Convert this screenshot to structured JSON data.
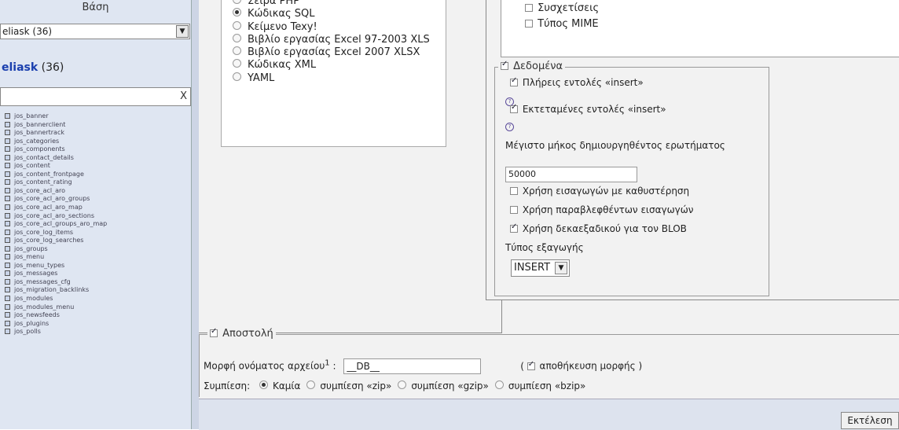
{
  "sidebar": {
    "title": "Βάση",
    "db_select_value": "eliask (36)",
    "db_link_name": "eliask",
    "db_link_count": "(36)",
    "filter_clear": "X",
    "tables": [
      "jos_banner",
      "jos_bannerclient",
      "jos_bannertrack",
      "jos_categories",
      "jos_components",
      "jos_contact_details",
      "jos_content",
      "jos_content_frontpage",
      "jos_content_rating",
      "jos_core_acl_aro",
      "jos_core_acl_aro_groups",
      "jos_core_acl_aro_map",
      "jos_core_acl_aro_sections",
      "jos_core_acl_groups_aro_map",
      "jos_core_log_items",
      "jos_core_log_searches",
      "jos_groups",
      "jos_menu",
      "jos_menu_types",
      "jos_messages",
      "jos_messages_cfg",
      "jos_migration_backlinks",
      "jos_modules",
      "jos_modules_menu",
      "jos_newsfeeds",
      "jos_plugins",
      "jos_polls"
    ]
  },
  "format": {
    "options": [
      {
        "label": "Σειρά PHP",
        "checked": false
      },
      {
        "label": "Κώδικας SQL",
        "checked": true
      },
      {
        "label": "Κείμενο Texy!",
        "checked": false
      },
      {
        "label": "Βιβλίο εργασίας Excel 97-2003 XLS",
        "checked": false
      },
      {
        "label": "Βιβλίο εργασίας Excel 2007 XLSX",
        "checked": false
      },
      {
        "label": "Κώδικας XML",
        "checked": false
      },
      {
        "label": "YAML",
        "checked": false
      }
    ]
  },
  "options_top": {
    "relations_label": "Συσχετίσεις",
    "mime_label": "Τύπος MIME"
  },
  "data_section": {
    "legend": "Δεδομένα",
    "complete_inserts": "Πλήρεις εντολές «insert»",
    "extended_inserts": "Εκτεταμένες εντολές «insert»",
    "maxlen_label": "Μέγιστο μήκος δημιουργηθέντος ερωτήματος",
    "maxlen_value": "50000",
    "delayed_inserts": "Χρήση εισαγωγών με καθυστέρηση",
    "ignore_inserts": "Χρήση παραβλεφθέντων εισαγωγών",
    "hex_blob": "Χρήση δεκαεξαδικού για τον BLOB",
    "export_type_label": "Τύπος εξαγωγής",
    "export_type_value": "INSERT"
  },
  "send_section": {
    "legend": "Αποστολή",
    "filename_label": "Μορφή ονόματος αρχείου",
    "filename_sup": "1",
    "filename_colon": ":",
    "filename_value": "__DB__",
    "remember_open": "(",
    "remember_label": "αποθήκευση μορφής )",
    "compression_label": "Συμπίεση:",
    "compression_options": [
      "Καμία",
      "συμπίεση «zip»",
      "συμπίεση «gzip»",
      "συμπίεση «bzip»"
    ]
  },
  "footer": {
    "go_label": "Εκτέλεση"
  }
}
